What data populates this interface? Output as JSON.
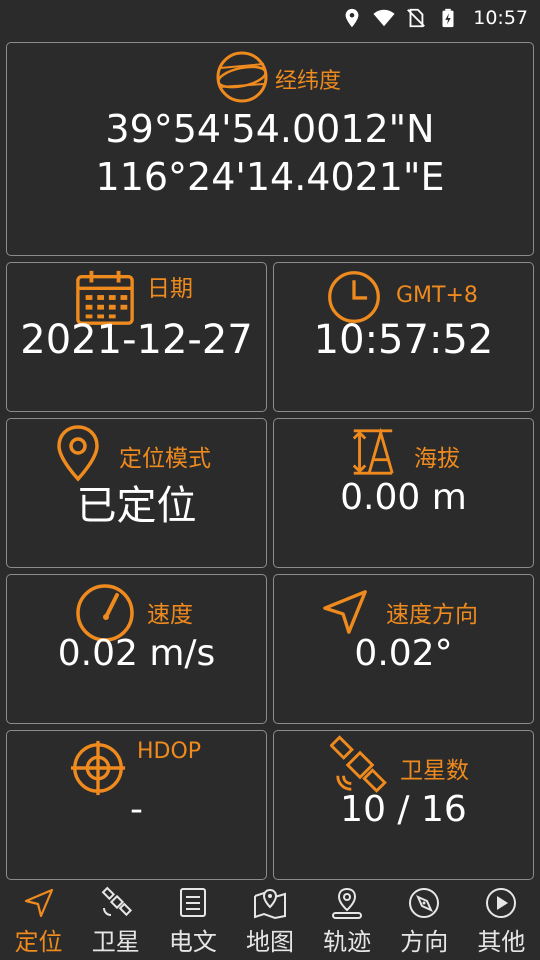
{
  "status_bar": {
    "time": "10:57",
    "icons": [
      "location-icon",
      "wifi-icon",
      "no-sim-icon",
      "battery-charging-icon"
    ]
  },
  "cards": {
    "coordinates": {
      "title": "经纬度",
      "latitude": "39°54'54.0012\"N",
      "longitude": "116°24'14.4021\"E",
      "icon": "globe-icon"
    },
    "date": {
      "title": "日期",
      "value": "2021-12-27",
      "icon": "calendar-icon"
    },
    "time": {
      "title": "GMT+8",
      "value": "10:57:52",
      "icon": "clock-icon"
    },
    "fix_mode": {
      "title": "定位模式",
      "value": "已定位",
      "icon": "map-pin-icon"
    },
    "altitude": {
      "title": "海拔",
      "value": "0.00 m",
      "icon": "altitude-icon"
    },
    "speed": {
      "title": "速度",
      "value": "0.02 m/s",
      "icon": "speedometer-icon"
    },
    "bearing": {
      "title": "速度方向",
      "value": "0.02°",
      "icon": "navigation-arrow-icon"
    },
    "hdop": {
      "title": "HDOP",
      "value": "-",
      "icon": "crosshair-icon"
    },
    "satellites": {
      "title": "卫星数",
      "value": "10 / 16",
      "icon": "satellite-icon"
    }
  },
  "nav": {
    "items": [
      {
        "label": "定位",
        "icon": "navigation-arrow-icon",
        "active": true
      },
      {
        "label": "卫星",
        "icon": "satellite-icon",
        "active": false
      },
      {
        "label": "电文",
        "icon": "document-icon",
        "active": false
      },
      {
        "label": "地图",
        "icon": "map-icon",
        "active": false
      },
      {
        "label": "轨迹",
        "icon": "track-pin-icon",
        "active": false
      },
      {
        "label": "方向",
        "icon": "compass-icon",
        "active": false
      },
      {
        "label": "其他",
        "icon": "play-circle-icon",
        "active": false
      }
    ]
  },
  "colors": {
    "accent": "#ee8a1e",
    "background": "#2b2b2b",
    "border": "#8c8c8c",
    "text": "#ffffff"
  }
}
